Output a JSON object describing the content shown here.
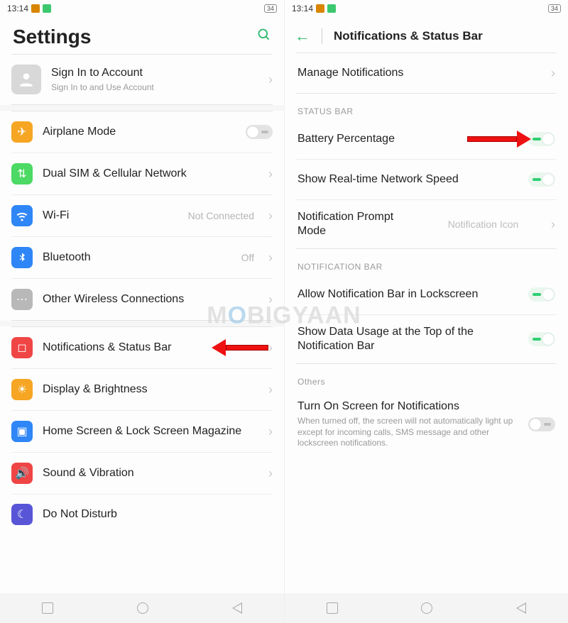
{
  "statusbar": {
    "time": "13:14",
    "battery": "34"
  },
  "left": {
    "title": "Settings",
    "signin": {
      "title": "Sign In to Account",
      "sub": "Sign In to and Use Account"
    },
    "items": [
      {
        "label": "Airplane Mode",
        "value": "",
        "toggle": "off"
      },
      {
        "label": "Dual SIM & Cellular Network",
        "value": ""
      },
      {
        "label": "Wi-Fi",
        "value": "Not Connected"
      },
      {
        "label": "Bluetooth",
        "value": "Off"
      },
      {
        "label": "Other Wireless Connections",
        "value": ""
      },
      {
        "label": "Notifications & Status Bar",
        "value": ""
      },
      {
        "label": "Display & Brightness",
        "value": ""
      },
      {
        "label": "Home Screen & Lock Screen Magazine",
        "value": ""
      },
      {
        "label": "Sound & Vibration",
        "value": ""
      },
      {
        "label": "Do Not Disturb",
        "value": ""
      }
    ]
  },
  "right": {
    "title": "Notifications & Status Bar",
    "manage": "Manage Notifications",
    "sections": {
      "status_bar": "STATUS BAR",
      "notification_bar": "NOTIFICATION BAR",
      "others": "Others"
    },
    "rows": {
      "battery_pct": "Battery Percentage",
      "net_speed": "Show Real-time Network Speed",
      "prompt_mode": {
        "label": "Notification Prompt Mode",
        "value": "Notification Icon"
      },
      "lockscreen_bar": "Allow Notification Bar in Lockscreen",
      "data_usage": "Show Data Usage at the Top of the Notification Bar",
      "turn_on_screen": {
        "label": "Turn On Screen for Notifications",
        "sub": "When turned off, the screen will not automatically light up except for incoming calls, SMS message and other lockscreen notifications."
      }
    }
  },
  "watermark": "MOBIGYAAN"
}
